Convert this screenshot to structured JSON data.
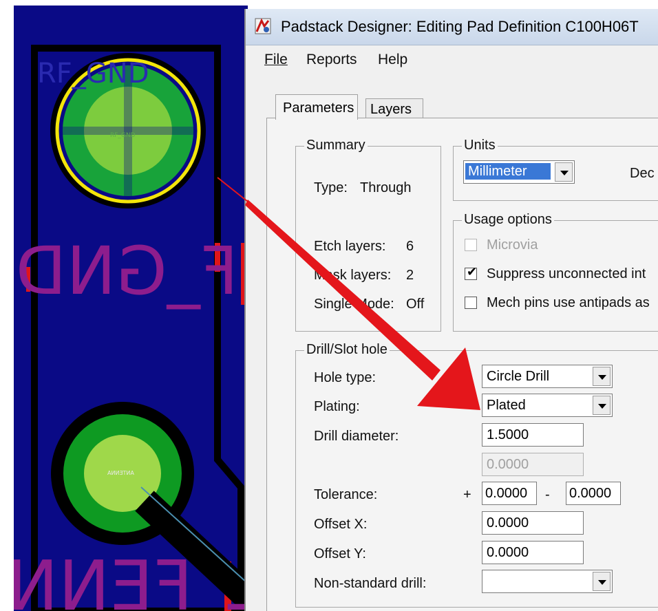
{
  "pcb": {
    "ref_text": "RF_GND",
    "pad_label_top": "RF_GND",
    "net_text_1": "F_GND",
    "net_text_2": "L_FENNA",
    "pad_label_bottom": "ANTENNA"
  },
  "window": {
    "title": "Padstack Designer: Editing Pad Definition C100H06T",
    "menu": [
      "File",
      "Reports",
      "Help"
    ],
    "tabs": [
      "Parameters",
      "Layers"
    ]
  },
  "summary": {
    "title": "Summary",
    "type_label": "Type:",
    "type_value": "Through",
    "etch_label": "Etch layers:",
    "etch_value": "6",
    "mask_label": "Mask layers:",
    "mask_value": "2",
    "single_label": "Single Mode:",
    "single_value": "Off"
  },
  "units": {
    "title": "Units",
    "selected": "Millimeter",
    "decimal_label": "Dec"
  },
  "usage": {
    "title": "Usage options",
    "microvia": "Microvia",
    "microvia_checked": false,
    "suppress": "Suppress unconnected int",
    "suppress_checked": true,
    "mech": "Mech pins use antipads as",
    "mech_checked": false
  },
  "drill": {
    "title": "Drill/Slot hole",
    "hole_type_label": "Hole type:",
    "hole_type_value": "Circle Drill",
    "plating_label": "Plating:",
    "plating_value": "Plated",
    "diameter_label": "Drill diameter:",
    "diameter_value": "1.5000",
    "slot_value": "0.0000",
    "tolerance_label": "Tolerance:",
    "tol_plus_sign": "+",
    "tol_plus_value": "0.0000",
    "tol_minus_sign": "-",
    "tol_minus_value": "0.0000",
    "offset_x_label": "Offset X:",
    "offset_x_value": "0.0000",
    "offset_y_label": "Offset Y:",
    "offset_y_value": "0.0000",
    "nonstd_label": "Non-standard drill:",
    "nonstd_value": ""
  },
  "colors": {
    "pcb_background": "#0a0a86",
    "pad_green": "#0f9a2a",
    "pad_center": "#8ecf3c",
    "selection_ring": "#f4e60a",
    "annotation_arrow": "#e4161b"
  }
}
